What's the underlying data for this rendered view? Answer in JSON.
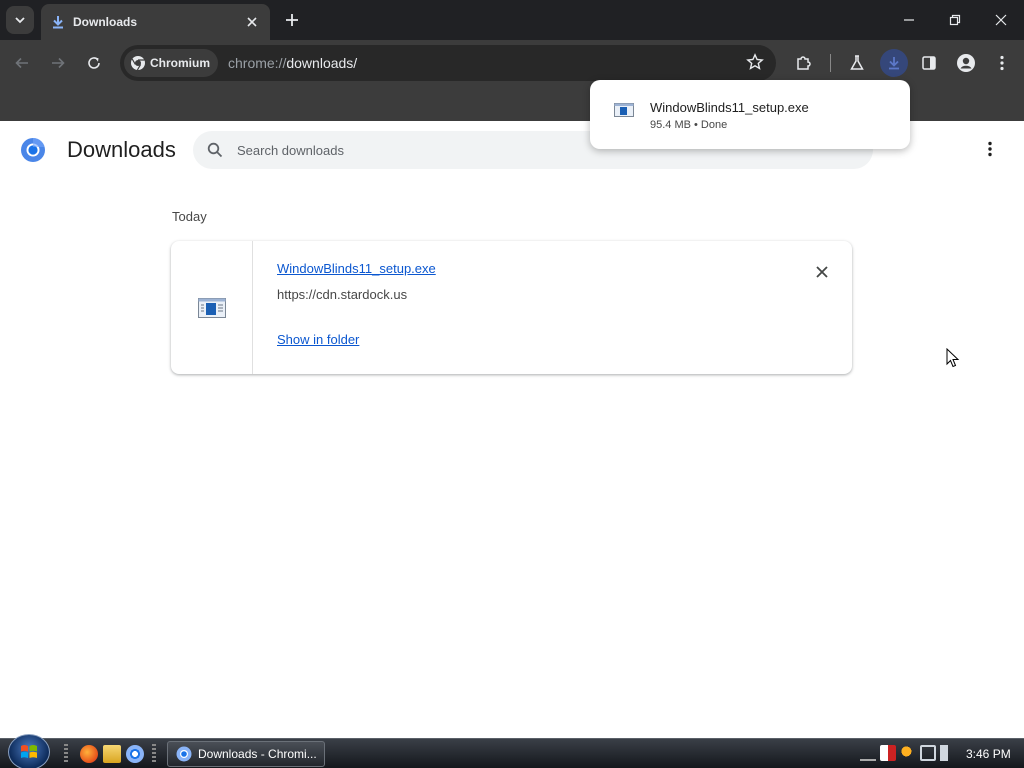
{
  "browser": {
    "tab_title": "Downloads",
    "omnibox": {
      "chip_label": "Chromium",
      "url_scheme": "chrome://",
      "url_path": "downloads/"
    }
  },
  "page": {
    "title": "Downloads",
    "search_placeholder": "Search downloads",
    "date_header": "Today",
    "download": {
      "file_name": "WindowBlinds11_setup.exe",
      "source_url": "https://cdn.stardock.us",
      "show_in_folder": "Show in folder"
    }
  },
  "bubble": {
    "file_name": "WindowBlinds11_setup.exe",
    "status": "95.4 MB • Done"
  },
  "taskbar": {
    "task_label": "Downloads - Chromi...",
    "clock": "3:46 PM"
  },
  "colors": {
    "link": "#0b57d0",
    "chrome_dark": "#202124",
    "toolbar": "#3c3c3c"
  }
}
